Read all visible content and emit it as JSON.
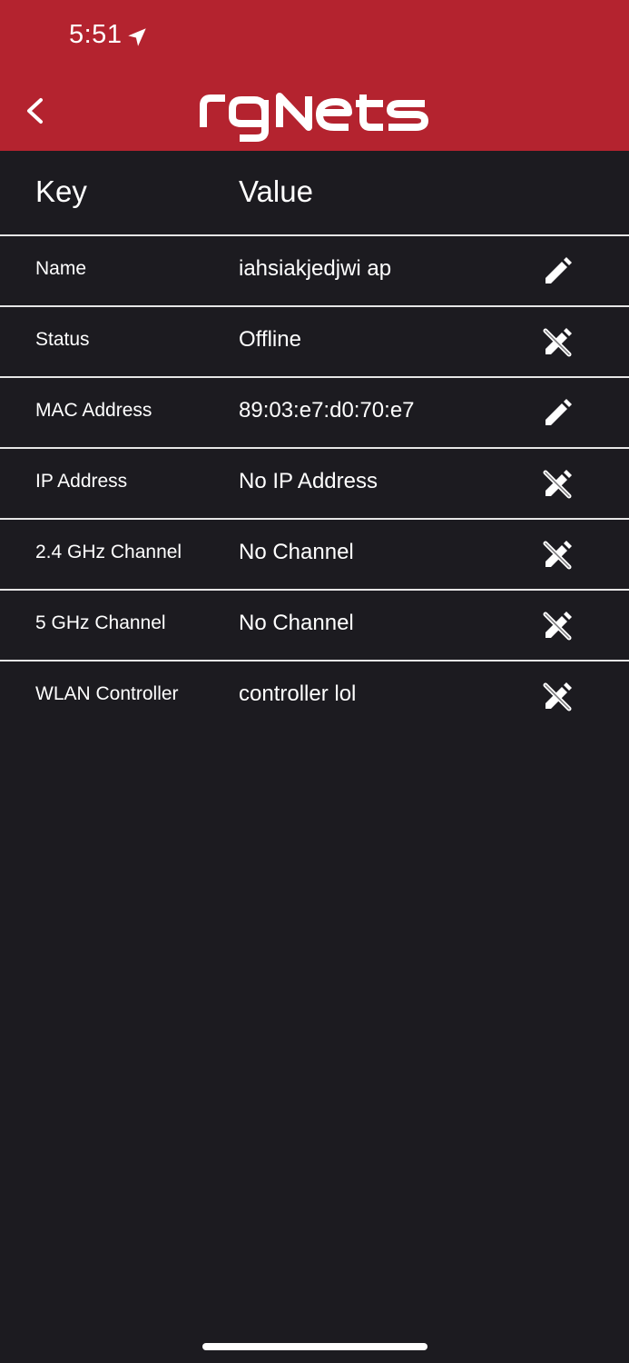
{
  "status_bar": {
    "time": "5:51",
    "location_icon": "location-arrow-icon"
  },
  "header": {
    "back_icon": "chevron-left-icon",
    "logo_text": "rgNets",
    "background_color": "#b4232f"
  },
  "table": {
    "key_header": "Key",
    "value_header": "Value",
    "rows": [
      {
        "key": "Name",
        "value": "iahsiakjedjwi ap",
        "action": "edit-pencil-icon",
        "editable": true
      },
      {
        "key": "Status",
        "value": "Offline",
        "action": "edit-disabled-icon",
        "editable": false
      },
      {
        "key": "MAC Address",
        "value": "89:03:e7:d0:70:e7",
        "action": "edit-pencil-icon",
        "editable": true
      },
      {
        "key": "IP Address",
        "value": "No IP Address",
        "action": "edit-disabled-icon",
        "editable": false
      },
      {
        "key": "2.4 GHz Channel",
        "value": "No Channel",
        "action": "edit-disabled-icon",
        "editable": false
      },
      {
        "key": "5 GHz Channel",
        "value": "No Channel",
        "action": "edit-disabled-icon",
        "editable": false
      },
      {
        "key": "WLAN Controller",
        "value": "controller lol",
        "action": "edit-disabled-icon",
        "editable": false
      }
    ]
  }
}
